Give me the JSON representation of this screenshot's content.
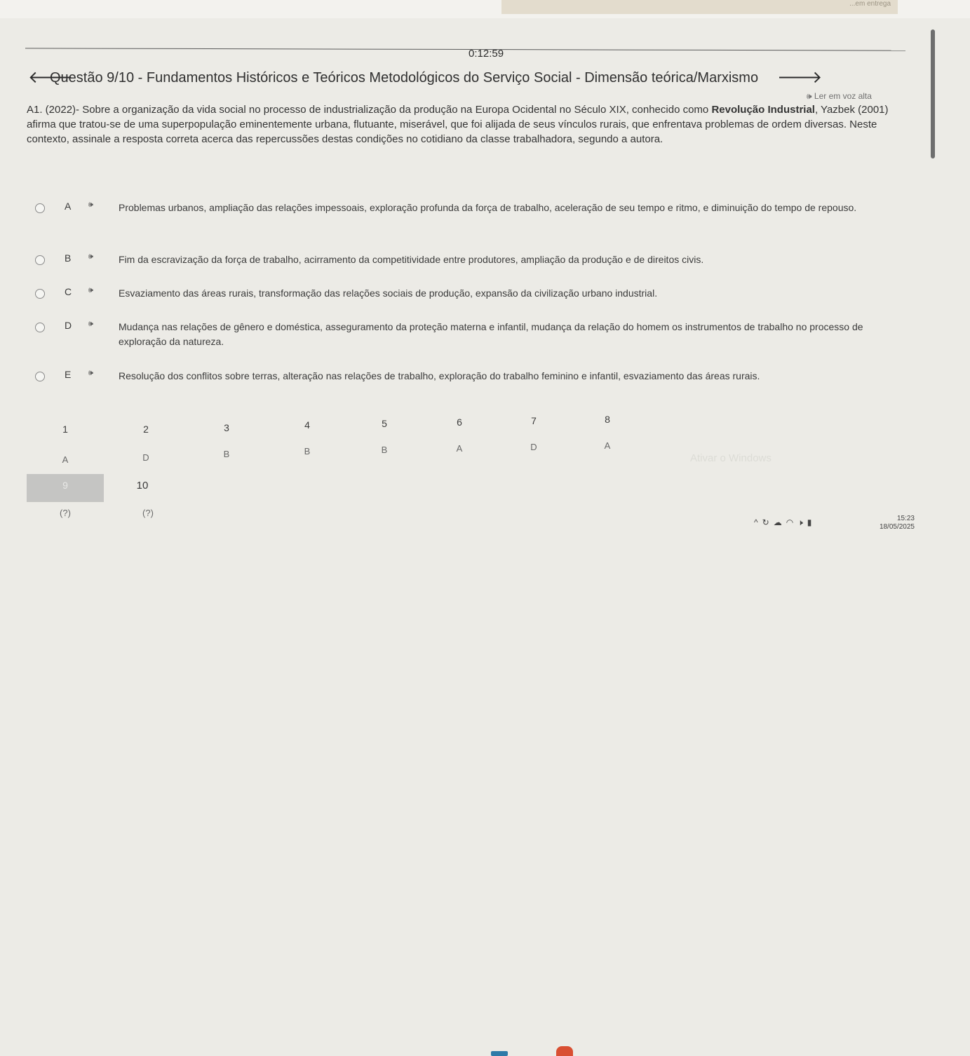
{
  "topbar": {
    "strip_text": "...em entrega"
  },
  "timer": "0:12:59",
  "header": {
    "back_icon": "arrow-left-icon",
    "title": "Questão 9/10 - Fundamentos Históricos e Teóricos Metodológicos do Serviço Social - Dimensão teórica/Marxismo",
    "forward_icon": "arrow-right-icon"
  },
  "read_aloud": "🕪 Ler em voz alta",
  "question": {
    "text_before": "A1. (2022)- Sobre a organização da vida social no processo de industrialização da produção na Europa Ocidental no Século XIX, conhecido como ",
    "emphasis": "Revolução Industrial",
    "text_after": ", Yazbek (2001) afirma que tratou-se de uma superpopulação eminentemente urbana, flutuante, miserável, que foi alijada de seus vínculos rurais, que enfrentava problemas de ordem diversas. Neste contexto, assinale a resposta correta acerca das repercussões destas condições no cotidiano da classe trabalhadora, segundo a autora."
  },
  "options": [
    {
      "letter": "A",
      "speaker": "🕪",
      "text": "Problemas urbanos, ampliação das relações impessoais, exploração profunda da força de trabalho, aceleração de seu tempo e ritmo, e diminuição do tempo de repouso."
    },
    {
      "letter": "B",
      "speaker": "🕪",
      "text": "Fim da escravização da força de trabalho, acirramento da competitividade entre produtores, ampliação da produção e de direitos civis."
    },
    {
      "letter": "C",
      "speaker": "🕪",
      "text": "Esvaziamento das áreas rurais, transformação das relações sociais de produção, expansão da civilização urbano industrial."
    },
    {
      "letter": "D",
      "speaker": "🕪",
      "text": "Mudança nas relações de gênero e doméstica, asseguramento da proteção materna e infantil, mudança da relação do homem os instrumentos de trabalho no processo de exploração da natureza."
    },
    {
      "letter": "E",
      "speaker": "🕪",
      "text": "Resolução dos conflitos sobre terras, alteração nas relações de trabalho, exploração do trabalho feminino e infantil, esvaziamento das áreas rurais."
    }
  ],
  "navigator": {
    "numbers": [
      "1",
      "2",
      "3",
      "4",
      "5",
      "6",
      "7",
      "8"
    ],
    "answers": [
      "A",
      "D",
      "B",
      "B",
      "B",
      "A",
      "D",
      "A"
    ],
    "current": "9",
    "next": "10",
    "unknown_9": "(?)",
    "unknown_10": "(?)"
  },
  "watermark": "Ativar o Windows",
  "system": {
    "tray_icons": [
      "chevron-up-icon",
      "sync-icon",
      "cloud-icon",
      "wifi-icon",
      "volume-icon",
      "battery-icon"
    ],
    "time": "15:23",
    "date": "18/05/2025"
  }
}
